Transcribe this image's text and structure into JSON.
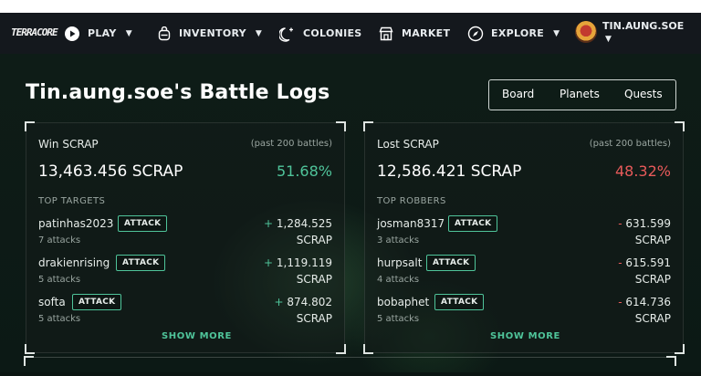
{
  "nav": {
    "logo": "TERRACORE",
    "play": "PLAY",
    "inventory": "INVENTORY",
    "colonies": "COLONIES",
    "market": "MARKET",
    "explore": "EXPLORE",
    "username": "TIN.AUNG.SOE"
  },
  "page": {
    "title": "Tin.aung.soe's Battle Logs",
    "tabs": [
      "Board",
      "Planets",
      "Quests"
    ]
  },
  "win": {
    "title": "Win SCRAP",
    "subtitle": "(past 200 battles)",
    "total": "13,463.456 SCRAP",
    "percent": "51.68%",
    "section": "TOP TARGETS",
    "rows": [
      {
        "name": "patinhas2023",
        "attacks": "7 attacks",
        "sign": "+",
        "amount": "1,284.525",
        "unit": "SCRAP",
        "button": "ATTACK"
      },
      {
        "name": "drakienrising",
        "attacks": "5 attacks",
        "sign": "+",
        "amount": "1,119.119",
        "unit": "SCRAP",
        "button": "ATTACK"
      },
      {
        "name": "softa",
        "attacks": "5 attacks",
        "sign": "+",
        "amount": "874.802",
        "unit": "SCRAP",
        "button": "ATTACK"
      }
    ],
    "show_more": "SHOW MORE"
  },
  "lost": {
    "title": "Lost SCRAP",
    "subtitle": "(past 200 battles)",
    "total": "12,586.421 SCRAP",
    "percent": "48.32%",
    "section": "TOP ROBBERS",
    "rows": [
      {
        "name": "josman8317",
        "attacks": "3 attacks",
        "sign": "-",
        "amount": "631.599",
        "unit": "SCRAP",
        "button": "ATTACK"
      },
      {
        "name": "hurpsalt",
        "attacks": "4 attacks",
        "sign": "-",
        "amount": "615.591",
        "unit": "SCRAP",
        "button": "ATTACK"
      },
      {
        "name": "bobaphet",
        "attacks": "5 attacks",
        "sign": "-",
        "amount": "614.736",
        "unit": "SCRAP",
        "button": "ATTACK"
      }
    ],
    "show_more": "SHOW MORE"
  },
  "colors": {
    "accent_green": "#4fc49a",
    "loss_red": "#e85a5a",
    "nav_bg": "#14181d",
    "page_bg": "#0e1c17"
  },
  "icons": {
    "play": "play-circle-icon",
    "inventory": "backpack-icon",
    "colonies": "moon-stars-icon",
    "market": "storefront-icon",
    "explore": "compass-icon"
  }
}
